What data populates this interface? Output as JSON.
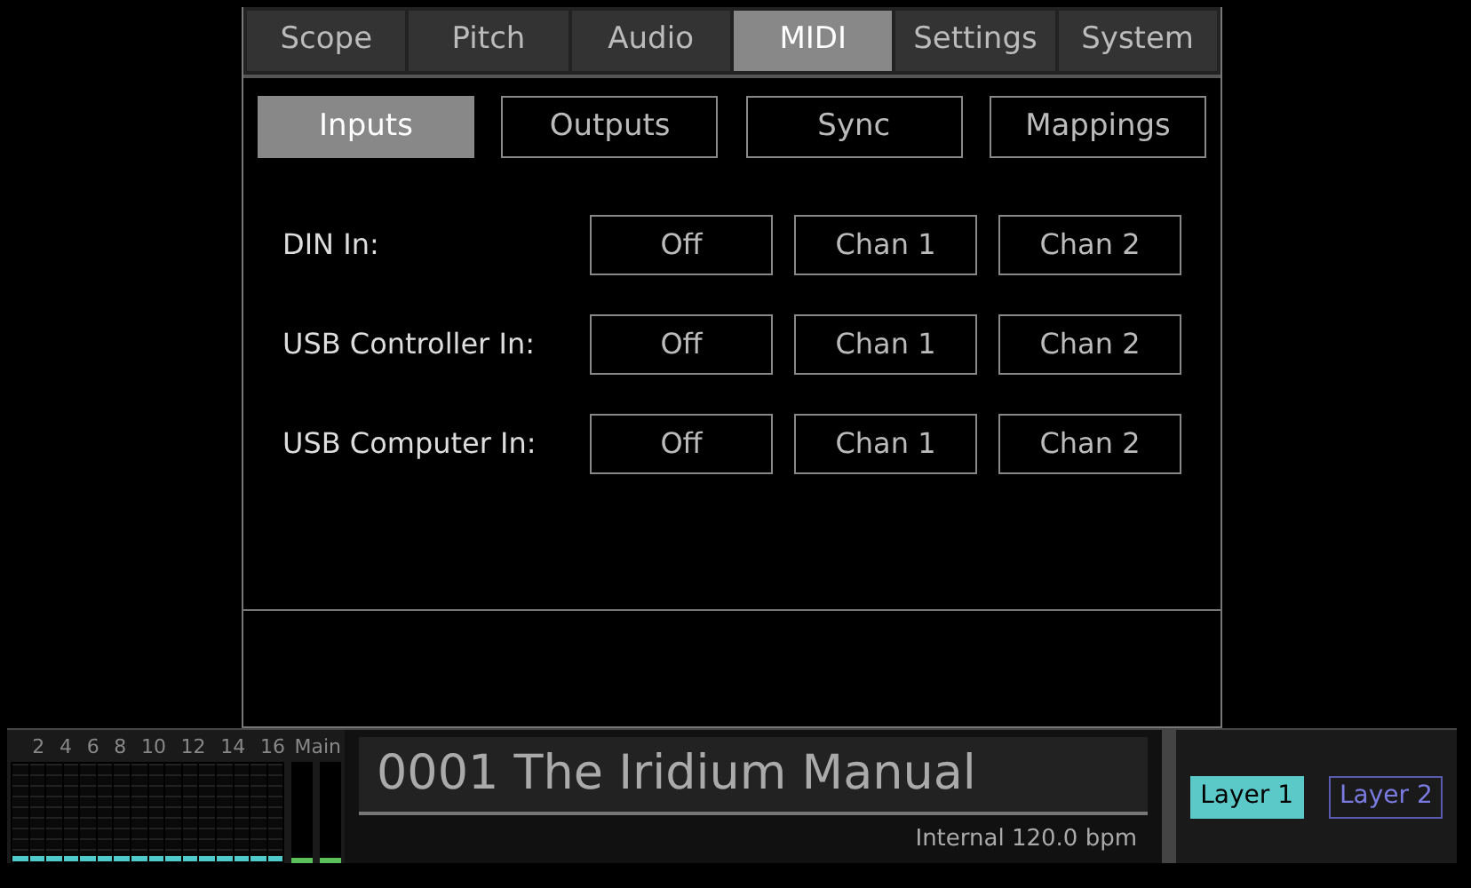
{
  "tabs": [
    {
      "label": "Scope",
      "selected": false
    },
    {
      "label": "Pitch",
      "selected": false
    },
    {
      "label": "Audio",
      "selected": false
    },
    {
      "label": "MIDI",
      "selected": true
    },
    {
      "label": "Settings",
      "selected": false
    },
    {
      "label": "System",
      "selected": false
    }
  ],
  "subtabs": [
    {
      "label": "Inputs",
      "selected": true
    },
    {
      "label": "Outputs",
      "selected": false
    },
    {
      "label": "Sync",
      "selected": false
    },
    {
      "label": "Mappings",
      "selected": false
    }
  ],
  "rows": [
    {
      "label": "DIN In:",
      "options": [
        {
          "label": "Off",
          "selected": false
        },
        {
          "label": "Chan 1",
          "selected": false
        },
        {
          "label": "Chan 2",
          "selected": false
        }
      ]
    },
    {
      "label": "USB Controller In:",
      "options": [
        {
          "label": "Off",
          "selected": false
        },
        {
          "label": "Chan 1",
          "selected": false
        },
        {
          "label": "Chan 2",
          "selected": false
        }
      ]
    },
    {
      "label": "USB Computer In:",
      "options": [
        {
          "label": "Off",
          "selected": false
        },
        {
          "label": "Chan 1",
          "selected": false
        },
        {
          "label": "Chan 2",
          "selected": false
        }
      ]
    }
  ],
  "meters": {
    "channel_labels": [
      "2",
      "4",
      "6",
      "8",
      "10",
      "12",
      "14",
      "16"
    ],
    "main_label": "Main"
  },
  "preset": {
    "name": "0001 The Iridium Manual",
    "clock": "Internal 120.0 bpm"
  },
  "layers": [
    {
      "label": "Layer 1",
      "selected": true
    },
    {
      "label": "Layer 2",
      "selected": false
    }
  ]
}
